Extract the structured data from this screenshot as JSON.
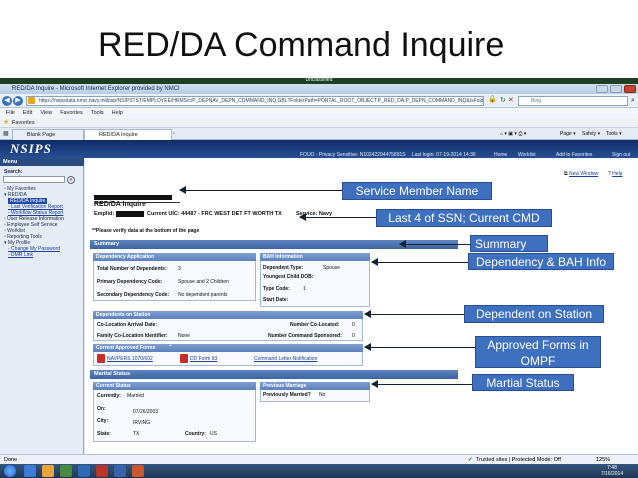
{
  "slide": {
    "title": "RED/DA Command Inquire"
  },
  "browser": {
    "classification": "Unclassified",
    "window_title": "RED/DA Inquire - Microsoft Internet Explorer provided by NMCI",
    "url": "https://nsipsdata.nmci.navy.mil/psp/NSIPSTST/EMPLOYEE/HRMS/c/P_DEPNAV_DEPN_COMMAND_INQ.GBL?FolderPath=PORTAL_ROOT_OBJECT.P_RED_DA.P_DEPN_COMMAND_INQ&IsFolder=false&IgnoreParamTempl=",
    "search_placeholder": "Bing",
    "menu": [
      "File",
      "Edit",
      "View",
      "Favorites",
      "Tools",
      "Help"
    ],
    "favorites_label": "Favorites",
    "tabs": [
      "Blank Page",
      "RED/DA Inquire"
    ],
    "tools": [
      "Page",
      "Safety",
      "Tools"
    ]
  },
  "app": {
    "logo": "NSIPS",
    "top_nav": [
      "FOUO - Privacy Sensitive: N10242294475891S",
      "Last login: 07-19-2014 14:36",
      "Home",
      "Worklist",
      "Add to Favorites",
      "Sign out"
    ],
    "new_window": "New Window",
    "help": "Help"
  },
  "leftnav": {
    "menu_label": "Menu",
    "search_label": "Search:",
    "go_label": "»",
    "items": [
      {
        "text": "My Favorites",
        "kind": "plain"
      },
      {
        "text": "RED/DA",
        "kind": "plain"
      },
      {
        "text": "RED/DA Inquire",
        "kind": "selected"
      },
      {
        "text": "- Last Verification Report",
        "kind": "link"
      },
      {
        "text": "- Workflow Status Report",
        "kind": "link"
      },
      {
        "text": "User Release Information",
        "kind": "plain"
      },
      {
        "text": "Employee Self Service",
        "kind": "plain"
      },
      {
        "text": "Worklist",
        "kind": "plain"
      },
      {
        "text": "Reporting Tools",
        "kind": "plain"
      },
      {
        "text": "My Profile",
        "kind": "plain"
      },
      {
        "text": "- Change My Password",
        "kind": "link"
      },
      {
        "text": "- DMR Link",
        "kind": "link"
      }
    ]
  },
  "main": {
    "page_heading": "RED/DA Inquire",
    "emplid_label": "Emplid:",
    "current_uic": "Current UIC: 44487 - FRC WEST DET FT WORTH TX",
    "service": "Service: Navy",
    "verify_note": "**Please verify data at the bottom of the page",
    "summary": "Summary",
    "dependency_app": {
      "header": "Dependency Application",
      "rows": [
        {
          "label": "Total Number of Dependents:",
          "value": "3"
        },
        {
          "label": "Primary Dependency Code:",
          "value": "Spouse and 2 Children"
        },
        {
          "label": "Secondary Dependency Code:",
          "value": "No dependent parents"
        }
      ]
    },
    "bah_info": {
      "header": "BAH Information",
      "rows": [
        {
          "label": "Dependent Type:",
          "value": "Spouse"
        },
        {
          "label": "Youngest Child DOB:",
          "value": ""
        },
        {
          "label": "Type Code:",
          "value": "1"
        },
        {
          "label": "Start Date:",
          "value": ""
        }
      ]
    },
    "dependents_station": {
      "header": "Dependents on Station",
      "colocation_arrival": "Co-Location Arrival Date:",
      "family_colocation": "Family Co-Location Identifier:",
      "family_colocation_value": "None",
      "number_colocated": "Number Co-Located:",
      "number_colocated_value": "0",
      "number_sponsored": "Number Command Sponsored:",
      "number_sponsored_value": "0"
    },
    "approved_forms": {
      "header": "Current Approved Forms",
      "forms": [
        "NAVPERS 1070/602",
        "DD Form 93"
      ],
      "notification": "Command Letter Notification"
    },
    "marital_status": {
      "header": "Marital Status",
      "current_header": "Current Status",
      "current_label": "Currently:",
      "current_value": "Married",
      "on_label": "On:",
      "on_value": "07/26/2003",
      "city_label": "City:",
      "city_value": "IRVING",
      "state_label": "State:",
      "state_value": "TX",
      "country_label": "Country:",
      "country_value": "US",
      "previous_header": "Previous Marriage",
      "previous_label": "Previously Married?",
      "previous_value": "No"
    }
  },
  "callouts": {
    "service_member": "Service Member Name",
    "ssn_cmd": "Last 4 of SSN; Current CMD",
    "summary": "Summary",
    "dependency_bah": "Dependency & BAH Info",
    "dependent_station": "Dependent on Station",
    "approved_forms_line1": "Approved Forms in",
    "approved_forms_line2": "OMPF",
    "marital_status": "Martial Status"
  },
  "statusbar": {
    "left": "Done",
    "zone": "Trusted sites | Protected Mode: Off",
    "zoom": "125%",
    "time": "7:48",
    "date": "7/16/2014"
  },
  "colors": {
    "callout": "#3f6fbf",
    "header_blue": "#0e2c66",
    "section_blue": "#3c64a2"
  }
}
